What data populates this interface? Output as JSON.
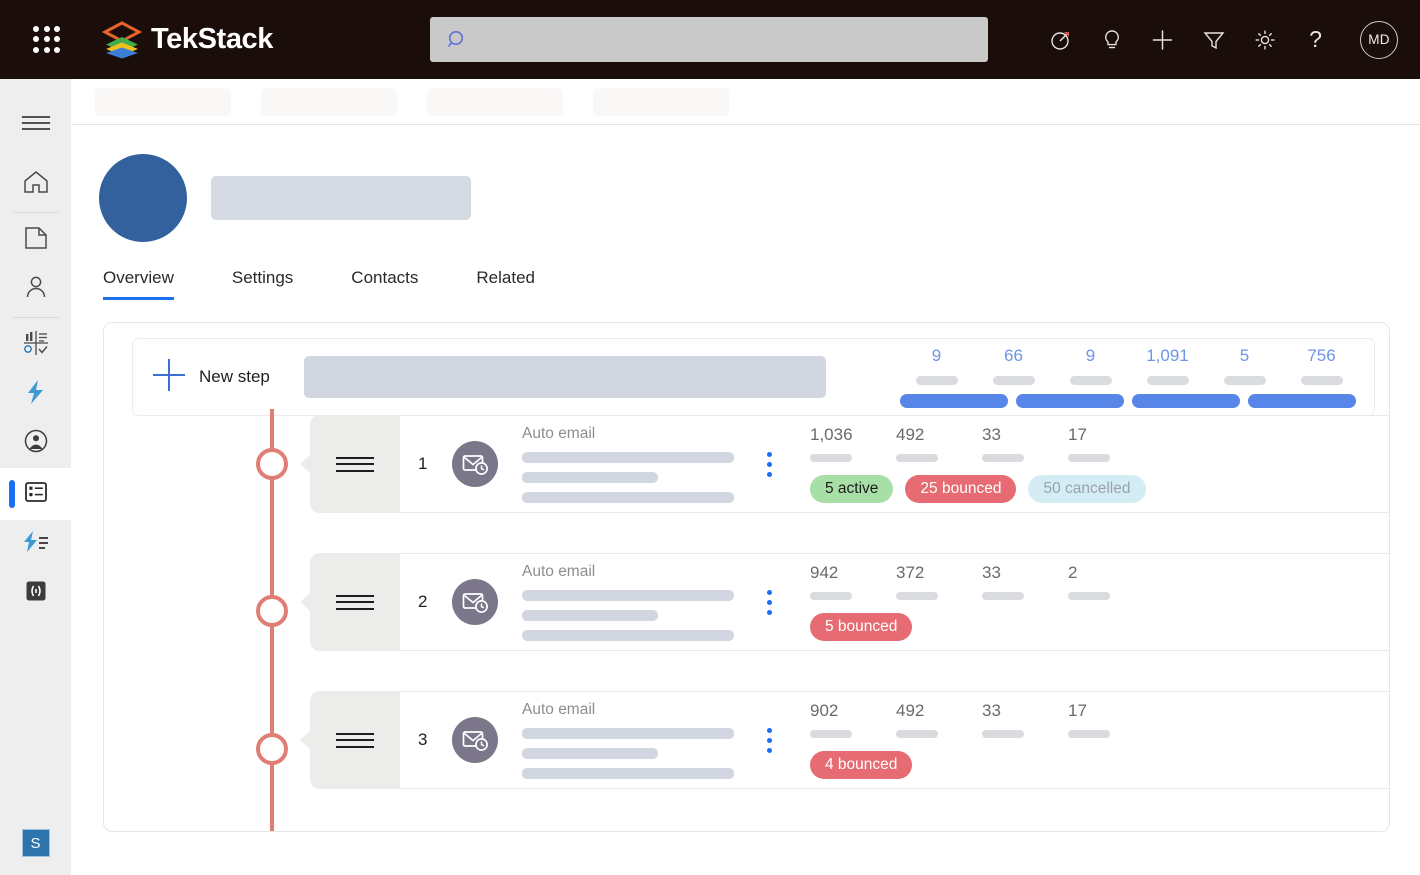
{
  "topbar": {
    "waffle_label": "app-launcher",
    "brand": "TekStack",
    "brand_colors": [
      "#e8622c",
      "#3fae49",
      "#f0c020",
      "#3d7fd6"
    ],
    "search": {
      "value": "",
      "placeholder": ""
    },
    "icons": [
      {
        "name": "target-arrow-icon",
        "glyph": "focus"
      },
      {
        "name": "lightbulb-icon",
        "glyph": "idea"
      },
      {
        "name": "plus-icon",
        "glyph": "add"
      },
      {
        "name": "filter-icon",
        "glyph": "funnel"
      },
      {
        "name": "gear-icon",
        "glyph": "settings"
      },
      {
        "name": "help-icon",
        "glyph": "?"
      }
    ],
    "help_label": "?",
    "avatar_initials": "MD"
  },
  "sidebar": {
    "items": [
      {
        "name": "hamburger-menu",
        "label": "Menu",
        "active": false
      },
      {
        "name": "home",
        "label": "Home",
        "active": false
      },
      {
        "name": "recent",
        "label": "Recent",
        "active": false
      },
      {
        "name": "contacts",
        "label": "Contacts",
        "active": false
      },
      {
        "name": "dashboards",
        "label": "Dashboards",
        "active": false
      },
      {
        "name": "quick-campaigns",
        "label": "Quick Campaigns",
        "active": false
      },
      {
        "name": "accounts",
        "label": "Accounts",
        "active": false
      },
      {
        "name": "sequences",
        "label": "Sequences",
        "active": true
      },
      {
        "name": "automation",
        "label": "Automation",
        "active": false
      },
      {
        "name": "developer",
        "label": "Developer",
        "active": false
      }
    ],
    "sandbox_badge": "S"
  },
  "breadcrumb": {
    "skeleton_widths": [
      136,
      136,
      136,
      136
    ]
  },
  "record": {
    "avatar_color": "#32619e",
    "title_skeleton_width": 260,
    "tabs": [
      {
        "label": "Overview",
        "active": true
      },
      {
        "label": "Settings",
        "active": false
      },
      {
        "label": "Contacts",
        "active": false
      },
      {
        "label": "Related",
        "active": false
      }
    ]
  },
  "sequence": {
    "new_step": {
      "label": "New step",
      "plus_icon": "plus-icon"
    },
    "header_stats": {
      "values": [
        "9",
        "66",
        "9",
        "1,091",
        "5",
        "756"
      ],
      "bar_count": 4,
      "value_color": "#6f93e8",
      "bar_color": "#5785e8"
    },
    "steps": [
      {
        "number": "1",
        "kind": "Auto email",
        "icon": "email-clock-icon",
        "stats": [
          "1,036",
          "492",
          "33",
          "17"
        ],
        "badges": [
          {
            "label": "5 active",
            "type": "active"
          },
          {
            "label": "25 bounced",
            "type": "bounced"
          },
          {
            "label": "50 cancelled",
            "type": "cancelled"
          }
        ]
      },
      {
        "number": "2",
        "kind": "Auto email",
        "icon": "email-clock-icon",
        "stats": [
          "942",
          "372",
          "33",
          "2"
        ],
        "badges": [
          {
            "label": "5 bounced",
            "type": "bounced"
          }
        ]
      },
      {
        "number": "3",
        "kind": "Auto email",
        "icon": "email-clock-icon",
        "stats": [
          "902",
          "492",
          "33",
          "17"
        ],
        "badges": [
          {
            "label": "4 bounced",
            "type": "bounced"
          }
        ]
      }
    ],
    "timeline_color": "#e07e76"
  }
}
